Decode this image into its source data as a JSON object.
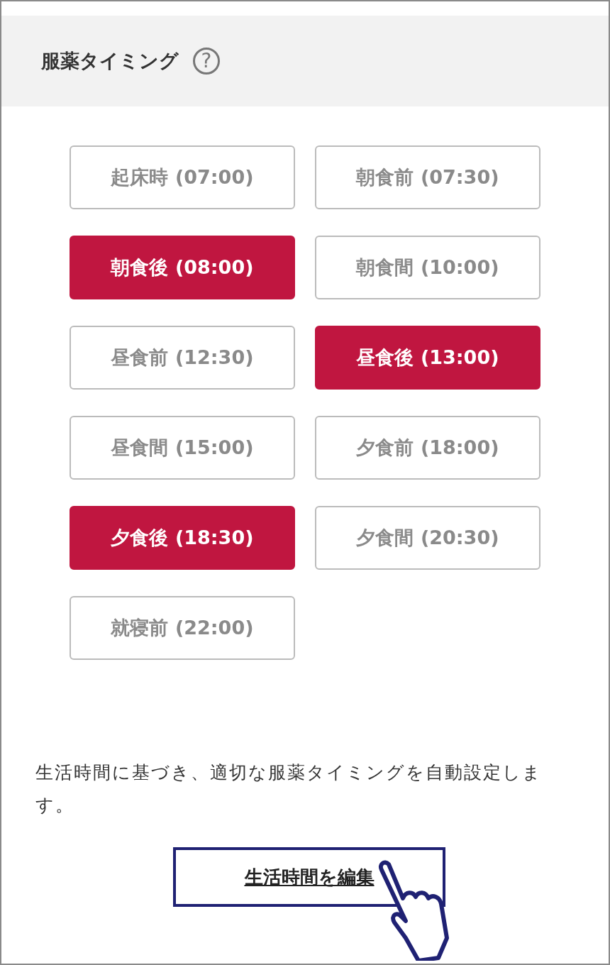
{
  "header": {
    "title": "服薬タイミング",
    "help": "?"
  },
  "timings": [
    {
      "label": "起床時 (07:00)",
      "selected": false
    },
    {
      "label": "朝食前 (07:30)",
      "selected": false
    },
    {
      "label": "朝食後 (08:00)",
      "selected": true
    },
    {
      "label": "朝食間 (10:00)",
      "selected": false
    },
    {
      "label": "昼食前 (12:30)",
      "selected": false
    },
    {
      "label": "昼食後 (13:00)",
      "selected": true
    },
    {
      "label": "昼食間 (15:00)",
      "selected": false
    },
    {
      "label": "夕食前 (18:00)",
      "selected": false
    },
    {
      "label": "夕食後 (18:30)",
      "selected": true
    },
    {
      "label": "夕食間 (20:30)",
      "selected": false
    },
    {
      "label": "就寝前 (22:00)",
      "selected": false
    }
  ],
  "description": "生活時間に基づき、適切な服薬タイミングを自動設定します。",
  "edit_button": "生活時間を編集"
}
